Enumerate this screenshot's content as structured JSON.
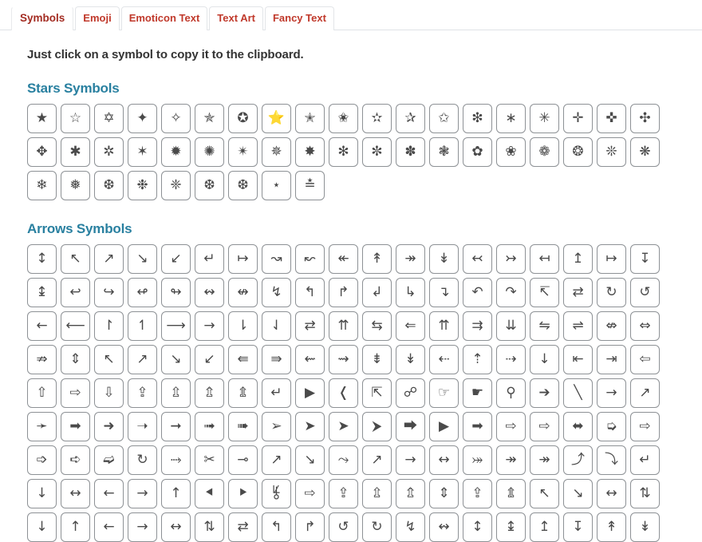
{
  "tabs": [
    {
      "label": "Symbols",
      "active": true
    },
    {
      "label": "Emoji",
      "active": false
    },
    {
      "label": "Emoticon Text",
      "active": false
    },
    {
      "label": "Text Art",
      "active": false
    },
    {
      "label": "Fancy Text",
      "active": false
    }
  ],
  "intro": "Just click on a symbol to copy it to the clipboard.",
  "colors": {
    "tab_text": "#c0392b",
    "tab_text_active": "#a32c22",
    "section_title": "#2980a0",
    "cell_border": "#8d9195",
    "body_text": "#333333"
  },
  "sections": [
    {
      "title": "Stars Symbols",
      "symbols": [
        "★",
        "☆",
        "✡",
        "✦",
        "✧",
        "✯",
        "✪",
        "⭐",
        "✭",
        "✬",
        "✫",
        "✰",
        "✩",
        "❇",
        "∗",
        "✳",
        "✛",
        "✜",
        "✣",
        "✥",
        "✱",
        "✲",
        "✶",
        "✹",
        "✺",
        "✴",
        "✵",
        "✸",
        "✻",
        "✼",
        "✽",
        "❃",
        "✿",
        "❀",
        "❁",
        "❂",
        "❊",
        "❋",
        "❄",
        "❅",
        "❆",
        "❉",
        "❈",
        "❆",
        "❆",
        "⋆",
        "≛"
      ]
    },
    {
      "title": "Arrows Symbols",
      "symbols": [
        "↕",
        "↖",
        "↗",
        "↘",
        "↙",
        "↵",
        "↦",
        "↝",
        "↜",
        "↞",
        "↟",
        "↠",
        "↡",
        "↢",
        "↣",
        "↤",
        "↥",
        "↦",
        "↧",
        "↨",
        "↩",
        "↪",
        "↫",
        "↬",
        "↭",
        "↮",
        "↯",
        "↰",
        "↱",
        "↲",
        "↳",
        "↴",
        "↶",
        "↷",
        "↸",
        "⇄",
        "↻",
        "↺",
        "←",
        "⟵",
        "↾",
        "↿",
        "⟶",
        "→",
        "⇂",
        "⇃",
        "⇄",
        "⇈",
        "⇆",
        "⇐",
        "⇈",
        "⇉",
        "⇊",
        "⇋",
        "⇌",
        "⇎",
        "⇔",
        "⇏",
        "⇕",
        "↖",
        "↗",
        "↘",
        "↙",
        "⇚",
        "⇛",
        "⇜",
        "⇝",
        "⇟",
        "↡",
        "⇠",
        "⇡",
        "⇢",
        "↓",
        "⇤",
        "⇥",
        "⇦",
        "⇧",
        "⇨",
        "⇩",
        "⇪",
        "⇫",
        "⇬",
        "⇭",
        "↵",
        "▶",
        "❬",
        "⇱",
        "☍",
        "☞",
        "☛",
        "⚲",
        "➔",
        "╲",
        "→",
        "↗",
        "➛",
        "➡",
        "➜",
        "➝",
        "➞",
        "➟",
        "➠",
        "➢",
        "➤",
        "➤",
        "⮞",
        "⮕",
        "▶",
        "➡",
        "⇨",
        "⇨",
        "⬌",
        "➭",
        "⇨",
        "➩",
        "➪",
        "➫",
        "↻",
        "⤑",
        "✂",
        "⊸",
        "↗",
        "↘",
        "⤳",
        "↗",
        "→",
        "↔",
        "⤖",
        "↠",
        "↠",
        "⤴",
        "⤵",
        "↵",
        "↓",
        "↔",
        "←",
        "→",
        "↑",
        "⯇",
        "⯈",
        "⯉",
        "⇨",
        "⇪",
        "⇫",
        "⇬",
        "⇕",
        "⇪",
        "⇭",
        "↖",
        "↘",
        "↔",
        "⇅",
        "↓",
        "↑",
        "←",
        "→",
        "↔",
        "⇅",
        "⇄",
        "↰",
        "↱",
        "↺",
        "↻",
        "↯",
        "↭",
        "↕",
        "↨",
        "↥",
        "↧",
        "↟",
        "↡"
      ]
    }
  ]
}
